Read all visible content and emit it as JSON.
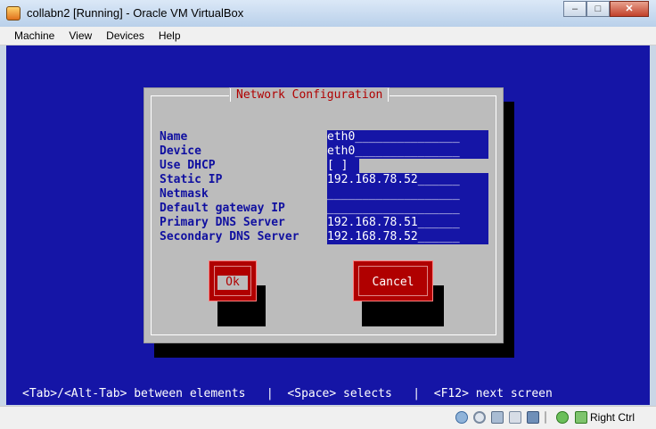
{
  "window": {
    "title": "collabn2 [Running] - Oracle VM VirtualBox",
    "minimize": "–",
    "maximize": "□",
    "close": "✕"
  },
  "menu": [
    "Machine",
    "View",
    "Devices",
    "Help"
  ],
  "dialog": {
    "title": "Network Configuration",
    "labels": [
      "Name",
      "Device",
      "Use DHCP",
      "Static IP",
      "Netmask",
      "Default gateway IP",
      "Primary DNS Server",
      "Secondary DNS Server"
    ],
    "fields": {
      "name": "eth0_______________",
      "device": "eth0_______________",
      "use_dhcp": "[ ]",
      "static_ip": "192.168.78.52______",
      "netmask": "___________________",
      "gateway": "___________________",
      "dns1": "192.168.78.51______",
      "dns2": "192.168.78.52______"
    },
    "ok_label": "Ok",
    "cancel_label": "Cancel"
  },
  "hint": "<Tab>/<Alt-Tab> between elements   |  <Space> selects   |  <F12> next screen",
  "statusbar": {
    "host_key": "Right Ctrl"
  }
}
